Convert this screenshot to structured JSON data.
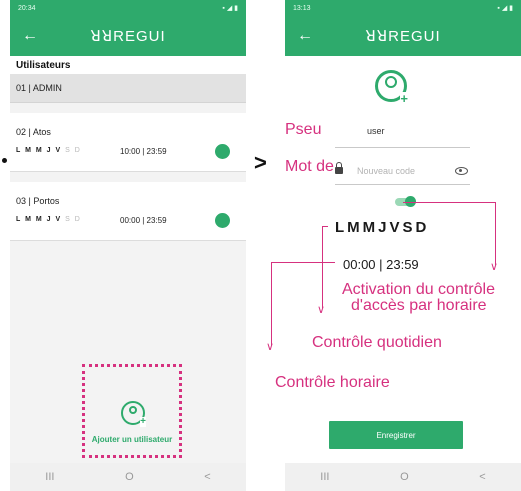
{
  "left_screen": {
    "status_time": "20:34",
    "app_title": "ꓤꓤREGUI",
    "section_title": "Utilisateurs",
    "users": [
      {
        "label": "01 | ADMIN"
      },
      {
        "label": "02 | Atos",
        "days_on": "L M M J V",
        "days_off": "S D",
        "time": "10:00 | 23:59"
      },
      {
        "label": "03 | Portos",
        "days_on": "L M M J V",
        "days_off": "S D",
        "time": "00:00 | 23:59"
      }
    ],
    "add_user_label": "Ajouter un utilisateur",
    "nav": {
      "recent": "III",
      "home": "O",
      "back": "<"
    }
  },
  "right_screen": {
    "status_time": "13:13",
    "app_title": "ꓤꓤREGUI",
    "username_value": "user",
    "password_placeholder": "Nouveau code",
    "days": "LMMJVSD",
    "time_range": "00:00 | 23:59",
    "save_label": "Enregistrer",
    "nav": {
      "recent": "III",
      "home": "O",
      "back": "<"
    }
  },
  "annotations": {
    "pseudo": "Pseu",
    "password": "Mot de",
    "activation_line1": "Activation du contrôle",
    "activation_line2": "d'accès par horaire",
    "daily_control": "Contrôle quotidien",
    "hourly_control": "Contrôle horaire"
  },
  "colors": {
    "brand_green": "#2eaa6c",
    "annotation_pink": "#d6317f"
  },
  "separator_arrow": ">"
}
